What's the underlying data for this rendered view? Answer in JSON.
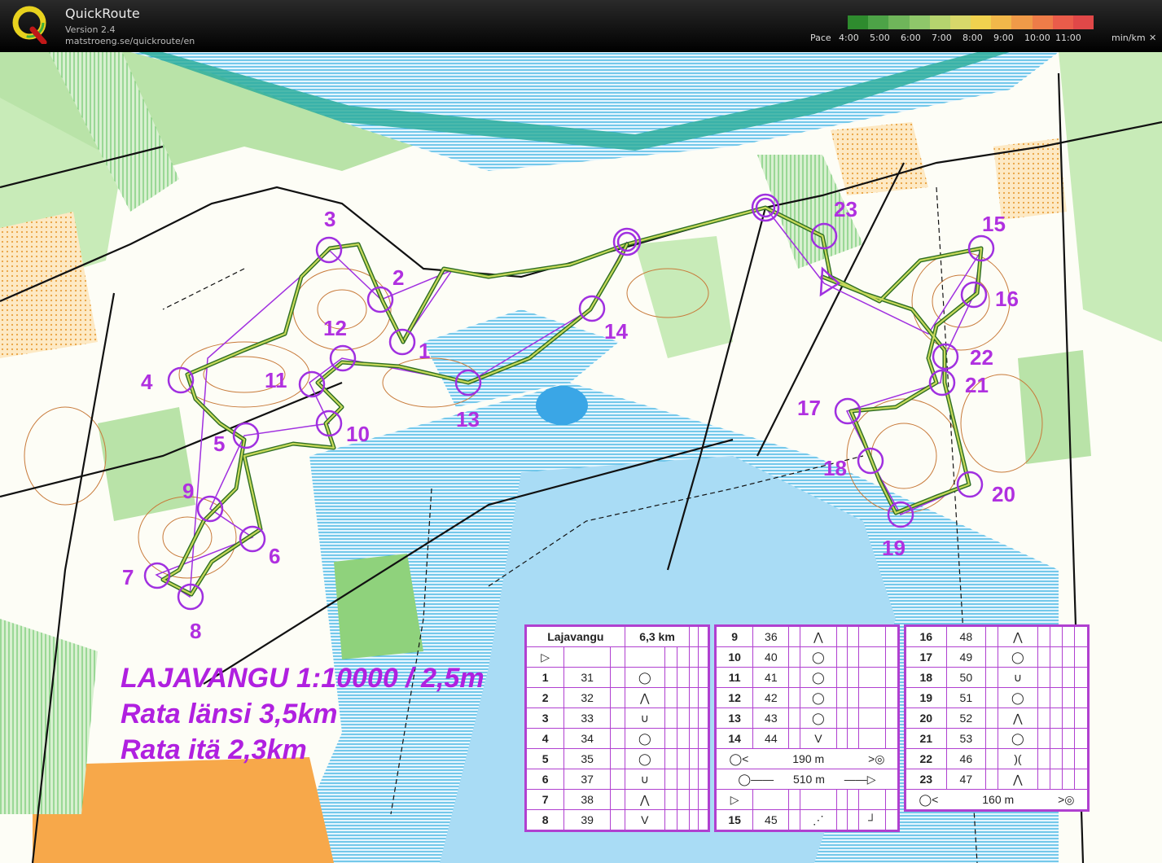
{
  "app": {
    "name": "QuickRoute",
    "version": "Version 2.4",
    "url": "matstroeng.se/quickroute/en"
  },
  "pace": {
    "label": "Pace",
    "ticks": [
      "4:00",
      "5:00",
      "6:00",
      "7:00",
      "8:00",
      "9:00",
      "10:00",
      "11:00"
    ],
    "unit": "min/km",
    "close": "✕",
    "gradient": [
      "#2e8b2e",
      "#4da347",
      "#6fb55a",
      "#8fc76a",
      "#b5d36e",
      "#d8d86a",
      "#f1d24f",
      "#f2b84a",
      "#f09a48",
      "#ee7c48",
      "#ea5c4a",
      "#e04848"
    ]
  },
  "map_text": {
    "line1": "LAJAVANGU 1:10000 / 2,5m",
    "line2": "Rata länsi 3,5km",
    "line3": "Rata itä 2,3km"
  },
  "controls": [
    "1",
    "2",
    "3",
    "4",
    "5",
    "6",
    "7",
    "8",
    "9",
    "10",
    "11",
    "12",
    "13",
    "14",
    "15",
    "16",
    "17",
    "18",
    "19",
    "20",
    "21",
    "22",
    "23"
  ],
  "description_tables": {
    "t1": {
      "event": "Lajavangu",
      "length": "6,3 km",
      "rows": [
        [
          "1",
          "31",
          "◯"
        ],
        [
          "2",
          "32",
          "⋀"
        ],
        [
          "3",
          "33",
          "∪"
        ],
        [
          "4",
          "34",
          "◯"
        ],
        [
          "5",
          "35",
          "◯"
        ],
        [
          "6",
          "37",
          "∪"
        ],
        [
          "7",
          "38",
          "⋀"
        ],
        [
          "8",
          "39",
          "V"
        ]
      ]
    },
    "t2": {
      "rows": [
        [
          "9",
          "36",
          "⋀"
        ],
        [
          "10",
          "40",
          "◯"
        ],
        [
          "11",
          "41",
          "◯"
        ],
        [
          "12",
          "42",
          "◯"
        ],
        [
          "13",
          "43",
          "◯"
        ],
        [
          "14",
          "44",
          "V"
        ]
      ],
      "leg1": "190 m",
      "leg2": "510 m",
      "last": [
        "15",
        "45"
      ]
    },
    "t3": {
      "rows": [
        [
          "16",
          "48",
          "⋀"
        ],
        [
          "17",
          "49",
          "◯"
        ],
        [
          "18",
          "50",
          "∪"
        ],
        [
          "19",
          "51",
          "◯"
        ],
        [
          "20",
          "52",
          "⋀"
        ],
        [
          "21",
          "53",
          "◯"
        ],
        [
          "22",
          "46",
          ")("
        ],
        [
          "23",
          "47",
          "⋀"
        ]
      ],
      "leg": "160 m"
    }
  }
}
